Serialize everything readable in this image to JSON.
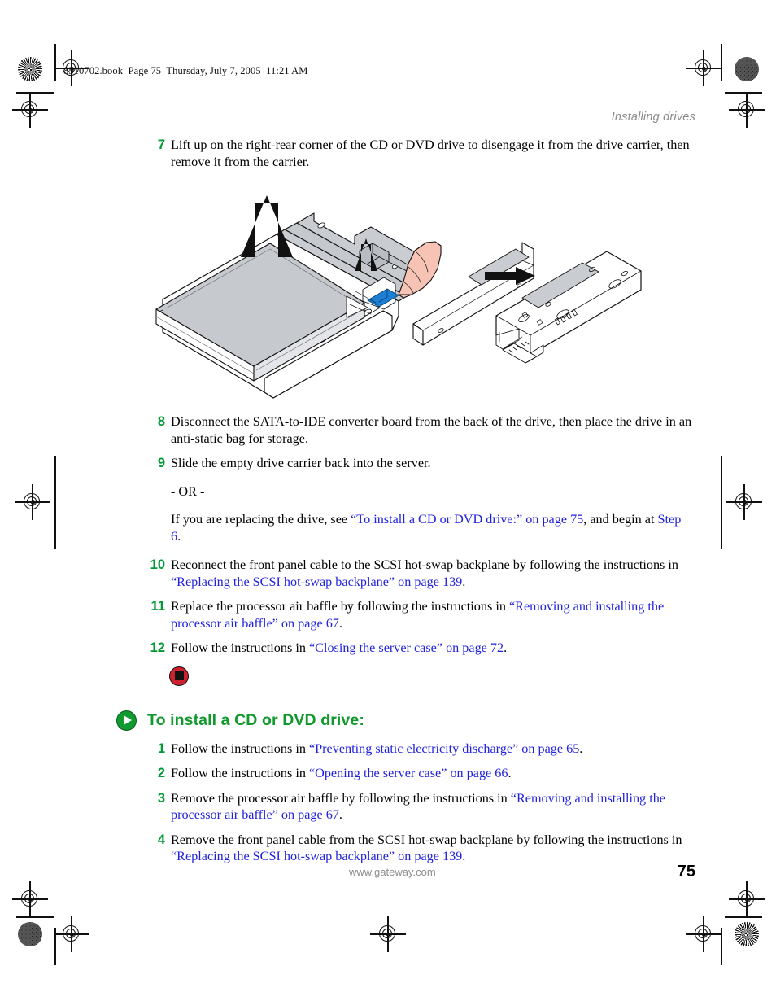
{
  "page": {
    "slug": "8510702.book  Page 75  Thursday, July 7, 2005  11:21 AM",
    "running_header": "Installing drives",
    "footer_url": "www.gateway.com",
    "page_number": "75",
    "colors": {
      "step_number_green": "#009933",
      "heading_green": "#11992e",
      "link_blue": "#2222dd",
      "header_gray": "#8a8a8a",
      "stop_red": "#cf2030"
    }
  },
  "procedure_remove": {
    "steps": [
      {
        "number": "7",
        "parts": [
          {
            "text": "Lift up on the right-rear corner of the CD or DVD drive to disengage it from the drive carrier, then remove it from the carrier.",
            "link": false
          }
        ]
      },
      {
        "number": "8",
        "parts": [
          {
            "text": "Disconnect the SATA-to-IDE converter board from the back of the drive, then place the drive in an anti-static bag for storage.",
            "link": false
          }
        ]
      },
      {
        "number": "9",
        "parts": [
          {
            "text": "Slide the empty drive carrier back into the server.",
            "link": false
          }
        ]
      }
    ],
    "or_text": "- OR -",
    "replacing_para": [
      {
        "text": "If you are replacing the drive, see ",
        "link": false
      },
      {
        "text": "“To install a CD or DVD drive:” on page 75",
        "link": true
      },
      {
        "text": ", and begin at ",
        "link": false
      },
      {
        "text": "Step 6",
        "link": true
      },
      {
        "text": ".",
        "link": false
      }
    ],
    "steps_cont": [
      {
        "number": "10",
        "parts": [
          {
            "text": "Reconnect the front panel cable to the SCSI hot-swap backplane by following the instructions in ",
            "link": false
          },
          {
            "text": "“Replacing the SCSI hot-swap backplane” on page 139",
            "link": true
          },
          {
            "text": ".",
            "link": false
          }
        ]
      },
      {
        "number": "11",
        "parts": [
          {
            "text": "Replace the processor air baffle by following the instructions in ",
            "link": false
          },
          {
            "text": "“Removing and installing the processor air baffle” on page 67",
            "link": true
          },
          {
            "text": ".",
            "link": false
          }
        ]
      },
      {
        "number": "12",
        "parts": [
          {
            "text": "Follow the instructions in ",
            "link": false
          },
          {
            "text": "“Closing the server case” on page 72",
            "link": true
          },
          {
            "text": ".",
            "link": false
          }
        ]
      }
    ]
  },
  "procedure_install": {
    "heading": "To install a CD or DVD drive:",
    "steps": [
      {
        "number": "1",
        "parts": [
          {
            "text": "Follow the instructions in ",
            "link": false
          },
          {
            "text": "“Preventing static electricity discharge” on page 65",
            "link": true
          },
          {
            "text": ".",
            "link": false
          }
        ]
      },
      {
        "number": "2",
        "parts": [
          {
            "text": "Follow the instructions in ",
            "link": false
          },
          {
            "text": "“Opening the server case” on page 66",
            "link": true
          },
          {
            "text": ".",
            "link": false
          }
        ]
      },
      {
        "number": "3",
        "parts": [
          {
            "text": "Remove the processor air baffle by following the instructions in ",
            "link": false
          },
          {
            "text": "“Removing and installing the processor air baffle” on page 67",
            "link": true
          },
          {
            "text": ".",
            "link": false
          }
        ]
      },
      {
        "number": "4",
        "parts": [
          {
            "text": "Remove the front panel cable from the SCSI hot-swap backplane by following the instructions in ",
            "link": false
          },
          {
            "text": "“Replacing the SCSI hot-swap backplane” on page 139",
            "link": true
          },
          {
            "text": ".",
            "link": false
          }
        ]
      }
    ]
  },
  "figure": {
    "caption": "",
    "description": "Exploded line drawing: CD or DVD drive lifted out of its drive carrier with a hand releasing a blue latch tab, shown next to the empty carrier rail and the SATA-to-IDE converter board."
  }
}
